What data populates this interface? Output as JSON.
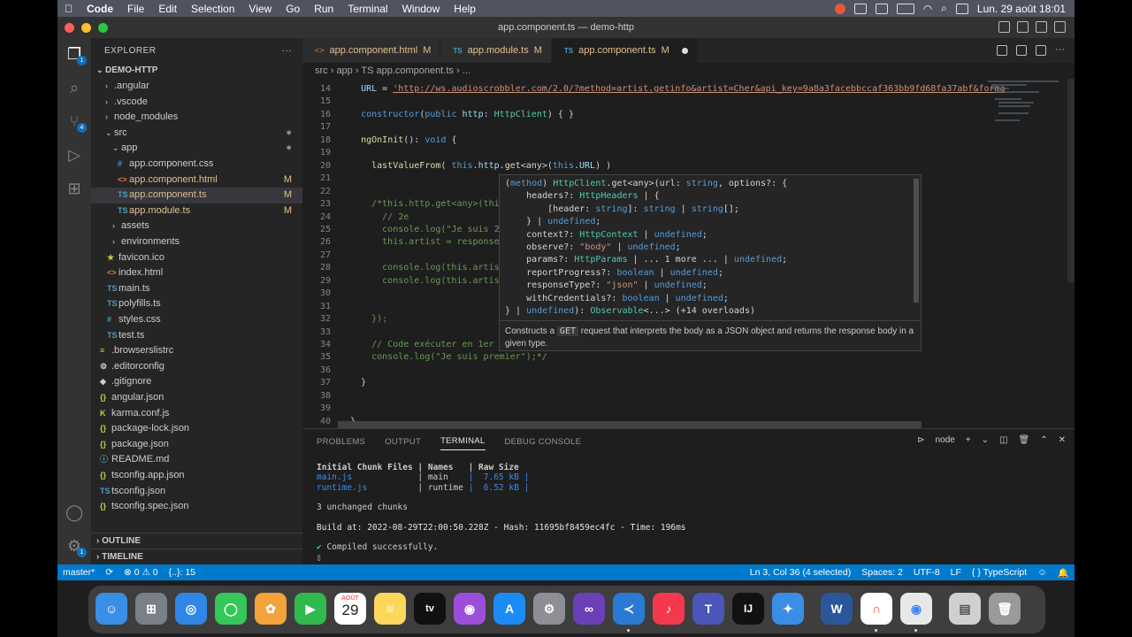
{
  "menubar": {
    "app": "Code",
    "items": [
      "File",
      "Edit",
      "Selection",
      "View",
      "Go",
      "Run",
      "Terminal",
      "Window",
      "Help"
    ],
    "clock": "Lun. 29 août  18:01"
  },
  "window": {
    "title": "app.component.ts — demo-http"
  },
  "activity": {
    "explorer_badge": "1",
    "scm_badge": "4",
    "settings_badge": "1"
  },
  "explorer": {
    "header": "EXPLORER",
    "more": "···",
    "project": "DEMO-HTTP",
    "items": [
      {
        "label": ".angular",
        "arrow": "›",
        "icon": "",
        "status": ""
      },
      {
        "label": ".vscode",
        "arrow": "›",
        "icon": "",
        "status": ""
      },
      {
        "label": "node_modules",
        "arrow": "›",
        "icon": "",
        "status": ""
      },
      {
        "label": "src",
        "arrow": "⌄",
        "icon": "",
        "status": "●"
      },
      {
        "label": "app",
        "arrow": "⌄",
        "icon": "",
        "status": "●"
      },
      {
        "label": "app.component.css",
        "arrow": "",
        "icon": "#",
        "status": ""
      },
      {
        "label": "app.component.html",
        "arrow": "",
        "icon": "<>",
        "status": "M"
      },
      {
        "label": "app.component.ts",
        "arrow": "",
        "icon": "TS",
        "status": "M"
      },
      {
        "label": "app.module.ts",
        "arrow": "",
        "icon": "TS",
        "status": "M"
      },
      {
        "label": "assets",
        "arrow": "›",
        "icon": "",
        "status": ""
      },
      {
        "label": "environments",
        "arrow": "›",
        "icon": "",
        "status": ""
      },
      {
        "label": "favicon.ico",
        "arrow": "",
        "icon": "★",
        "status": ""
      },
      {
        "label": "index.html",
        "arrow": "",
        "icon": "<>",
        "status": ""
      },
      {
        "label": "main.ts",
        "arrow": "",
        "icon": "TS",
        "status": ""
      },
      {
        "label": "polyfills.ts",
        "arrow": "",
        "icon": "TS",
        "status": ""
      },
      {
        "label": "styles.css",
        "arrow": "",
        "icon": "#",
        "status": ""
      },
      {
        "label": "test.ts",
        "arrow": "",
        "icon": "TS",
        "status": ""
      },
      {
        "label": ".browserslistrc",
        "arrow": "",
        "icon": "≡",
        "status": ""
      },
      {
        "label": ".editorconfig",
        "arrow": "",
        "icon": "⚙",
        "status": ""
      },
      {
        "label": ".gitignore",
        "arrow": "",
        "icon": "◆",
        "status": ""
      },
      {
        "label": "angular.json",
        "arrow": "",
        "icon": "{}",
        "status": ""
      },
      {
        "label": "karma.conf.js",
        "arrow": "",
        "icon": "K",
        "status": ""
      },
      {
        "label": "package-lock.json",
        "arrow": "",
        "icon": "{}",
        "status": ""
      },
      {
        "label": "package.json",
        "arrow": "",
        "icon": "{}",
        "status": ""
      },
      {
        "label": "README.md",
        "arrow": "",
        "icon": "ⓘ",
        "status": ""
      },
      {
        "label": "tsconfig.app.json",
        "arrow": "",
        "icon": "{}",
        "status": ""
      },
      {
        "label": "tsconfig.json",
        "arrow": "",
        "icon": "TS",
        "status": ""
      },
      {
        "label": "tsconfig.spec.json",
        "arrow": "",
        "icon": "{}",
        "status": ""
      }
    ],
    "outline": "OUTLINE",
    "timeline": "TIMELINE"
  },
  "tabs": [
    {
      "label": "app.component.html",
      "lang": "<>",
      "flag": "M",
      "active": false
    },
    {
      "label": "app.module.ts",
      "lang": "TS",
      "flag": "M",
      "active": false
    },
    {
      "label": "app.component.ts",
      "lang": "TS",
      "flag": "M",
      "active": true
    }
  ],
  "breadcrumbs": "src  ›  app  ›  TS app.component.ts  ›  ...",
  "code": [
    {
      "n": "14",
      "t": "    URL = 'http://ws.audioscrobbler.com/2.0/?method=artist.getinfo&artist=Cher&api_key=9a8a3facebbccaf363bb9fd68fa37abf&forma"
    },
    {
      "n": "15",
      "t": ""
    },
    {
      "n": "16",
      "t": "    constructor(public http: HttpClient) { }"
    },
    {
      "n": "17",
      "t": ""
    },
    {
      "n": "18",
      "t": "    ngOnInit(): void {"
    },
    {
      "n": "19",
      "t": ""
    },
    {
      "n": "20",
      "t": "      lastValueFrom( this.http.get<any>(this.URL) )"
    },
    {
      "n": "21",
      "t": ""
    },
    {
      "n": "22",
      "t": ""
    },
    {
      "n": "23",
      "t": "      /*this.http.get<any>(this"
    },
    {
      "n": "24",
      "t": "        // 2e"
    },
    {
      "n": "25",
      "t": "        console.log(\"Je suis 2e"
    },
    {
      "n": "26",
      "t": "        this.artist = response;"
    },
    {
      "n": "27",
      "t": ""
    },
    {
      "n": "28",
      "t": "        console.log(this.artist"
    },
    {
      "n": "29",
      "t": "        console.log(this.artist"
    },
    {
      "n": "30",
      "t": ""
    },
    {
      "n": "31",
      "t": ""
    },
    {
      "n": "32",
      "t": "      });"
    },
    {
      "n": "33",
      "t": ""
    },
    {
      "n": "34",
      "t": "      // Code exécuter en 1er"
    },
    {
      "n": "35",
      "t": "      console.log(\"Je suis premier\");*/"
    },
    {
      "n": "36",
      "t": ""
    },
    {
      "n": "37",
      "t": "    }"
    },
    {
      "n": "38",
      "t": ""
    },
    {
      "n": "39",
      "t": ""
    },
    {
      "n": "40",
      "t": "  }"
    }
  ],
  "hover": {
    "lines": [
      "(method) HttpClient.get<any>(url: string, options?: {",
      "    headers?: HttpHeaders | {",
      "        [header: string]: string | string[];",
      "    } | undefined;",
      "    context?: HttpContext | undefined;",
      "    observe?: \"body\" | undefined;",
      "    params?: HttpParams | ... 1 more ... | undefined;",
      "    reportProgress?: boolean | undefined;",
      "    responseType?: \"json\" | undefined;",
      "    withCredentials?: boolean | undefined;",
      "} | undefined): Observable<...> (+14 overloads)"
    ],
    "doc_pre": "Constructs a ",
    "doc_code": "GET",
    "doc_post": " request that interprets the body as a JSON object and returns the response body in a given type."
  },
  "panel": {
    "tabs": [
      "PROBLEMS",
      "OUTPUT",
      "TERMINAL",
      "DEBUG CONSOLE"
    ],
    "active": "TERMINAL",
    "shell": "node",
    "terminal": [
      "Initial Chunk Files | Names   | Raw Size",
      "main.js             | main    |  7.65 kB |",
      "runtime.js          | runtime |  6.52 kB |",
      "",
      "3 unchanged chunks",
      "",
      "Build at: 2022-08-29T22:00:50.228Z - Hash: 11695bf8459ec4fc - Time: 196ms",
      "",
      "✔ Compiled successfully.",
      "▯"
    ]
  },
  "status": {
    "branch": "master*",
    "sync": "⟳",
    "errors": "⊗ 0  ⚠ 0",
    "braces": "{..}: 15",
    "position": "Ln 3, Col 36 (4 selected)",
    "spaces": "Spaces: 2",
    "encoding": "UTF-8",
    "eol": "LF",
    "language": "{ } TypeScript"
  },
  "dock": {
    "calendar_month": "AOÛT",
    "calendar_day": "29"
  },
  "colors": {
    "accent": "#007acc",
    "keyword": "#569cd6",
    "string": "#ce9178",
    "function": "#dcdcaa",
    "type": "#4ec9b0",
    "variable": "#9cdcfe",
    "comment": "#6a9955"
  }
}
